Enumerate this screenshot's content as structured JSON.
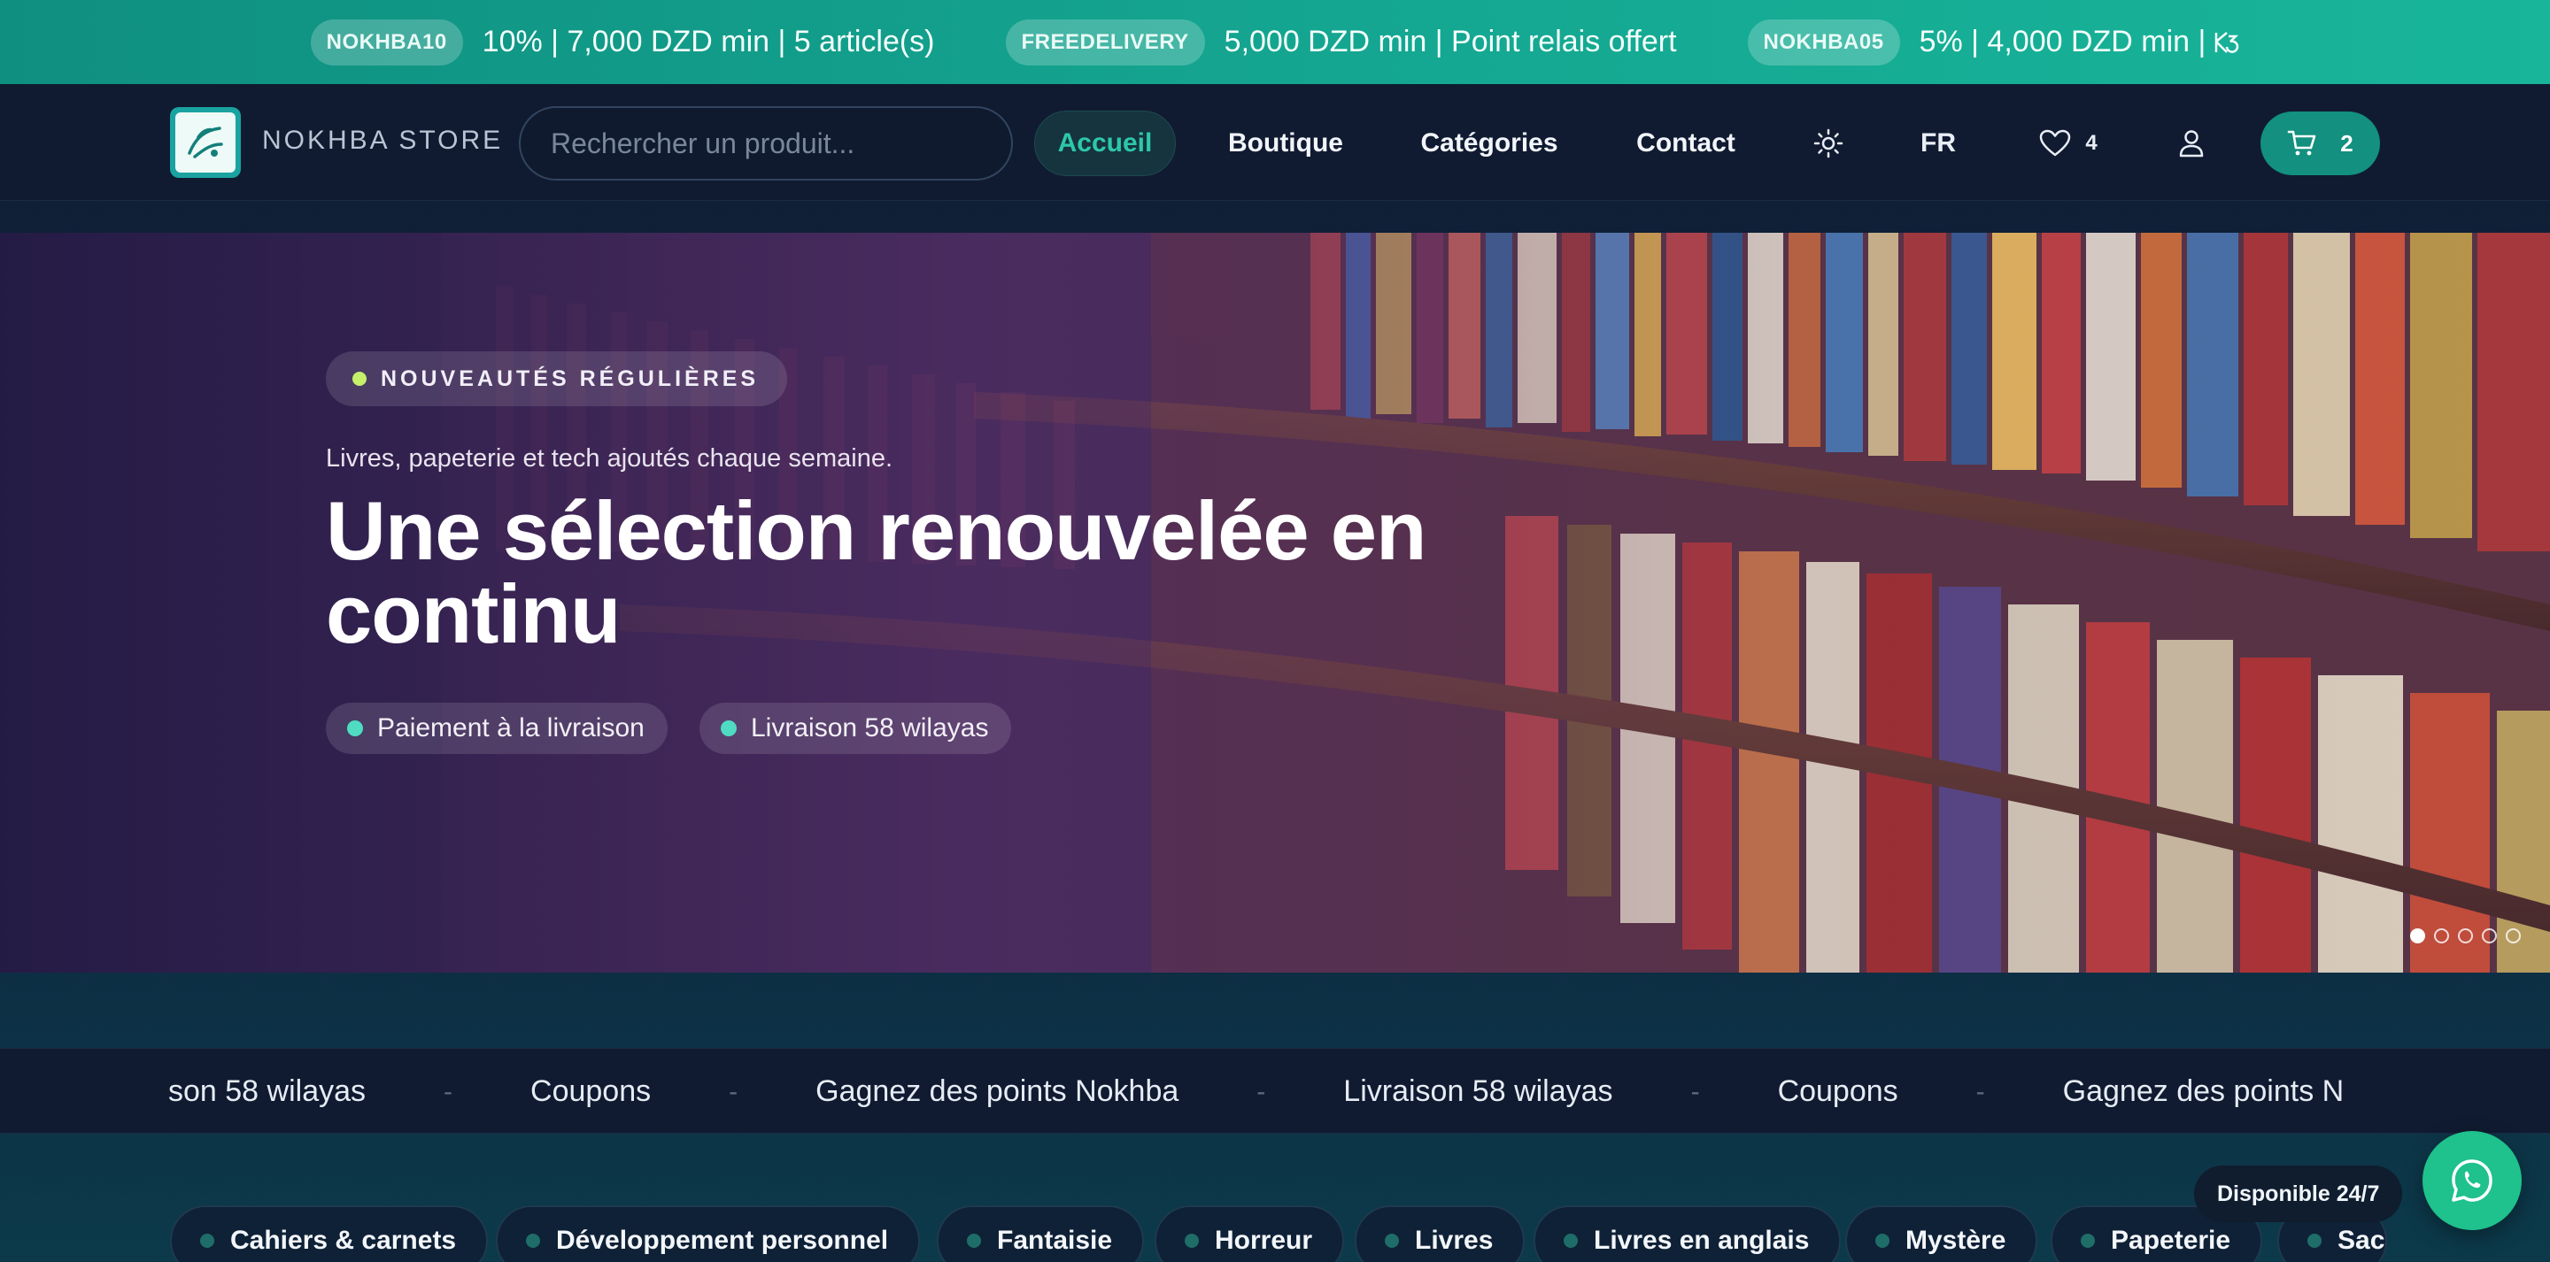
{
  "promo_bar": {
    "promos": [
      {
        "code": "NOKHBA10",
        "text": "10% | 7,000 DZD min | 5 article(s)"
      },
      {
        "code": "FREEDELIVERY",
        "text": "5,000 DZD min | Point relais offert"
      },
      {
        "code": "NOKHBA05",
        "text": "5% | 4,000 DZD min |"
      }
    ]
  },
  "header": {
    "brand": "NOKHBA STORE",
    "search_placeholder": "Rechercher un produit...",
    "nav": {
      "home": "Accueil",
      "shop": "Boutique",
      "categories": "Catégories",
      "contact": "Contact"
    },
    "language": "FR",
    "wishlist_count": "4",
    "cart_count": "2",
    "icons": [
      "sun-icon",
      "heart-icon",
      "user-icon",
      "cart-icon"
    ]
  },
  "hero": {
    "badge": "NOUVEAUTÉS RÉGULIÈRES",
    "subtitle": "Livres, papeterie et tech ajoutés chaque semaine.",
    "title": "Une sélection renouvelée en continu",
    "chips": [
      "Paiement à la livraison",
      "Livraison 58 wilayas"
    ],
    "slide_count": 5,
    "active_slide": 1
  },
  "ticker": {
    "items": [
      "son 58 wilayas",
      "Coupons",
      "Gagnez des points Nokhba",
      "Livraison 58 wilayas",
      "Coupons",
      "Gagnez des points N"
    ],
    "separator": "-"
  },
  "categories": [
    "Cahiers & carnets",
    "Développement personnel",
    "Fantaisie",
    "Horreur",
    "Livres",
    "Livres en anglais",
    "Mystère",
    "Papeterie",
    "Sac"
  ],
  "whatsapp": {
    "label": "Disponible 24/7"
  },
  "colors": {
    "accent": "#13907f",
    "promo_bar": "#14a590",
    "header_bg": "#101b31",
    "whatsapp": "#1fc18d"
  }
}
